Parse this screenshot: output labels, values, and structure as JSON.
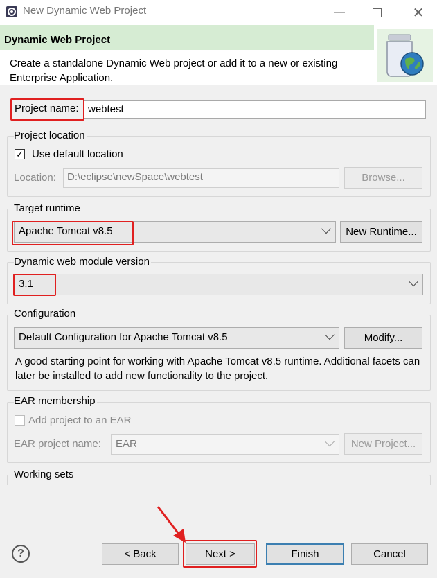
{
  "window": {
    "title": "New Dynamic Web Project",
    "minimize_icon": "minimize-icon",
    "maximize_icon": "maximize-icon",
    "close_icon": "close-icon"
  },
  "header": {
    "title": "Dynamic Web Project",
    "description": "Create a standalone Dynamic Web project or add it to a new or existing Enterprise Application."
  },
  "project_name": {
    "label": "Project name:",
    "value": "webtest"
  },
  "project_location": {
    "group_title": "Project location",
    "use_default_label": "Use default location",
    "use_default_checked": true,
    "location_label": "Location:",
    "location_value": "D:\\eclipse\\newSpace\\webtest",
    "browse_label": "Browse..."
  },
  "target_runtime": {
    "group_title": "Target runtime",
    "selected": "Apache Tomcat v8.5",
    "new_runtime_label": "New Runtime..."
  },
  "module_version": {
    "group_title": "Dynamic web module version",
    "selected": "3.1"
  },
  "configuration": {
    "group_title": "Configuration",
    "selected": "Default Configuration for Apache Tomcat v8.5",
    "modify_label": "Modify...",
    "description": "A good starting point for working with Apache Tomcat v8.5 runtime. Additional facets can later be installed to add new functionality to the project."
  },
  "ear": {
    "group_title": "EAR membership",
    "add_label": "Add project to an EAR",
    "add_checked": false,
    "name_label": "EAR project name:",
    "name_value": "EAR",
    "new_project_label": "New Project..."
  },
  "working_sets": {
    "group_title": "Working sets"
  },
  "footer": {
    "help_label": "?",
    "back_label": "< Back",
    "next_label": "Next >",
    "finish_label": "Finish",
    "cancel_label": "Cancel"
  },
  "colors": {
    "highlight": "#e02020",
    "annotation_arrow": "#e02020",
    "banner": "#d6ecd3"
  }
}
